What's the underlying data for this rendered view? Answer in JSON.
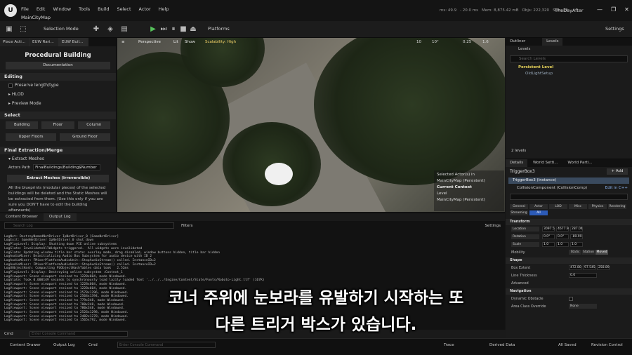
{
  "menubar": {
    "menus": [
      "File",
      "Edit",
      "Window",
      "Tools",
      "Build",
      "Select",
      "Actor",
      "Help"
    ],
    "map_tab": "MainCityMap",
    "stats": [
      "ms: 49.9",
      "- 20.0 ms",
      "Mem: 8,875.42 mB",
      "Objs: 222,320",
      "Stdr: 35"
    ],
    "project": "TheDayAfter",
    "window_buttons": [
      "—",
      "❐",
      "✕"
    ]
  },
  "toolbar": {
    "selection_mode": "Selection Mode",
    "platforms": "Platforms",
    "settings": "Settings"
  },
  "left_panel": {
    "tabs": [
      "Place Acti...",
      "EUW Rari...",
      "EUW Buil..."
    ],
    "title": "Procedural Building",
    "documentation": "Documentation",
    "editing_header": "Editing",
    "preserve": "Preserve length/type",
    "hlod": "HLOD",
    "preview_mode": "Preview Mode",
    "select_header": "Select",
    "select_buttons": [
      "Building",
      "Floor",
      "Column"
    ],
    "floor_buttons": [
      "Upper Floors",
      "Ground Floor"
    ],
    "final_header": "Final Extraction/Merge",
    "extract_meshes_header": "Extract Meshes",
    "actors_path_label": "Actors Path",
    "actors_path_value": "FinalBuildings/Building$Number",
    "extract_button": "Extract Meshes (irreversible)",
    "note": "All the blueprints (modular pieces) of the selected buildings will be deleted and the Static Meshes will be extracted from them. (Use this only if you are sure you DON'T have to edit the building afterwards)"
  },
  "viewport": {
    "perspective": "Perspective",
    "lit": "Lit",
    "show": "Show",
    "scalability": "Scalability: High",
    "right_values": [
      "10",
      "10°",
      "0.25",
      "1.6"
    ],
    "selected_actor_label": "Selected Actor(s) in",
    "selected_actor_map": "MainCityMap (Persistent)",
    "current_context": "Current Context",
    "level_label": "Level",
    "level_value": "MainCityMap (Persistent)"
  },
  "outliner": {
    "tabs": [
      "Outliner",
      "Levels"
    ],
    "levels_dropdown": "Levels",
    "search_placeholder": "Search Levels",
    "persistent_level": "Persistent Level",
    "sublevel": "OldLightSetup",
    "levels_count": "2 levels"
  },
  "details": {
    "tabs": [
      "Details",
      "World Setti...",
      "World Parti..."
    ],
    "actor": "TriggerBox3",
    "add_button": "+ Add",
    "instance": "TriggerBox3 (Instance)",
    "component": "CollisionComponent (CollisionComp)",
    "edit_cpp": "Edit in C++",
    "category_tabs": [
      "General",
      "Actor",
      "LOD",
      "Misc",
      "Physics",
      "Rendering",
      "Streaming",
      "All"
    ],
    "transform_header": "Transform",
    "location_label": "Location",
    "location_values": [
      "3097.5",
      "4677.9",
      "287.04"
    ],
    "rotation_label": "Rotation",
    "rotation_values": [
      "0.0°",
      "0.0°",
      "-89.99"
    ],
    "scale_label": "Scale",
    "scale_values": [
      "1.0",
      "1.0",
      "1.0"
    ],
    "mobility_label": "Mobility",
    "mobility_options": [
      "Static",
      "Station",
      "Moved"
    ],
    "shape_header": "Shape",
    "box_extent_label": "Box Extent",
    "box_extent_values": [
      "472.80",
      "97.545",
      "258.89"
    ],
    "line_thickness_label": "Line Thickness",
    "line_thickness_value": "0.0",
    "advanced_label": "Advanced",
    "navigation_header": "Navigation",
    "dynamic_obstacle_label": "Dynamic Obstacle",
    "area_class_label": "Area Class Override",
    "area_class_value": "None"
  },
  "bottom": {
    "tabs": [
      "Content Browser",
      "Output Log"
    ],
    "search_placeholder": "Search Log",
    "filters": "Filters",
    "settings": "Settings",
    "log_lines": [
      "LogNet: DestroyNamedNetDriver IpNetDriver_0 [GameNetDriver]",
      "LogExit: GameNetDriver IpNetDriver_0 shut down",
      "LogPlayLevel: Display: Shutting down PIE online subsystems",
      "LogSlate: InvalidateAllWidgets triggered.  All widgets were invalidated",
      "LogSlate: Updating window title bar state: overlay mode, drag disabled, window buttons hidden, title bar hidden",
      "LogAudioMixer: Deinitializing Audio Bus Subsystem for audio device with ID 2",
      "LogAudioMixer: FMixerPlatformAudioUnit::StopAudioStream() called. InstanceID=2",
      "LogAudioMixer: FMixerPlatformAudioUnit::StopAudioStream() called. InstanceID=2",
      "LogUObjectHash: Compacting FUObjectHashTables data took   2.52ms",
      "LogPlayLevel: Display: Destroying online subsystem :Context_1",
      "LogViewport: Scene viewport resized to 1228x604, mode Windowed.",
      "LogSlate: Took 0.000149 seconds to synchronously load lazily loaded font '../../../Engine/Content/Slate/Fonts/Roboto-Light.ttf' (167K)",
      "LogViewport: Scene viewport resized to 1228x604, mode Windowed.",
      "LogViewport: Scene viewport resized to 1228x604, mode Windowed.",
      "LogViewport: Scene viewport resized to 2578x1296, mode Windowed.",
      "LogViewport: Scene viewport resized to 2564x1394, mode Windowed.",
      "LogViewport: Scene viewport resized to 779x348, mode Windowed.",
      "LogViewport: Scene viewport resized to 780x348, mode Windowed.",
      "LogViewport: Scene viewport resized to 780x348, mode Windowed.",
      "LogViewport: Scene viewport resized to 2526x1298, mode Windowed.",
      "LogViewport: Scene viewport resized to 2482x1278, mode Windowed.",
      "LogViewport: Scene viewport resized to 1565x792, mode Windowed."
    ],
    "cmd_label": "Cmd",
    "cmd_placeholder": "Enter Console Command"
  },
  "statusbar": {
    "content_drawer": "Content Drawer",
    "output_log": "Output Log",
    "cmd": "Cmd",
    "console_placeholder": "Enter Console Command",
    "trace": "Trace",
    "derived_data": "Derived Data",
    "all_saved": "All Saved",
    "revision_control": "Revision Control"
  },
  "subtitle": {
    "line1": "코너 주위에 눈보라를 유발하기 시작하는 또",
    "line2": "다른 트리거 박스가 있습니다."
  }
}
